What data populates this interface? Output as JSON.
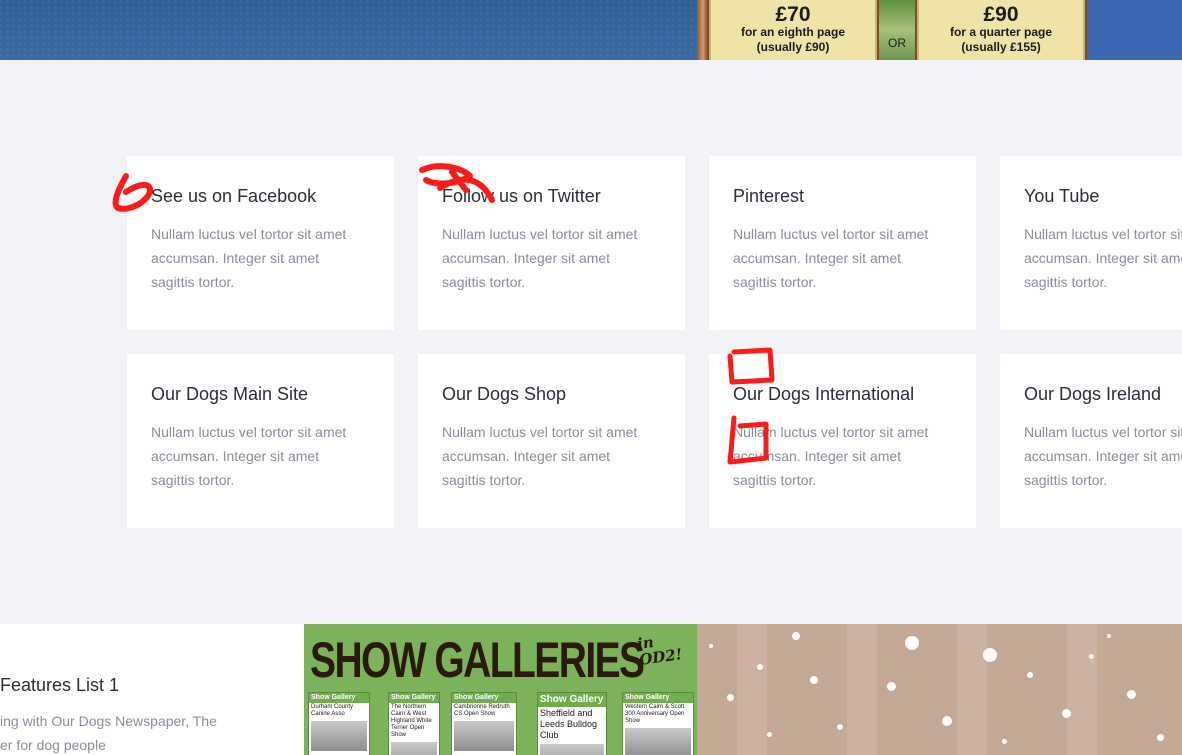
{
  "top_banner": {
    "offer_one": {
      "price": "£70",
      "line1": "for an eighth page",
      "line2": "(usually £90)"
    },
    "or_label": "OR",
    "offer_two": {
      "price": "£90",
      "line1": "for a quarter page",
      "line2": "(usually £155)"
    }
  },
  "cards": [
    {
      "title": "See us on Facebook",
      "text": [
        "Nullam luctus vel tortor sit amet",
        "accumsan. Integer sit amet",
        "sagittis tortor."
      ]
    },
    {
      "title": "Follow us on Twitter",
      "text": [
        "Nullam luctus vel tortor sit amet",
        "accumsan. Integer sit amet",
        "sagittis tortor."
      ]
    },
    {
      "title": "Pinterest",
      "text": [
        "Nullam luctus vel tortor sit amet",
        "accumsan. Integer sit amet",
        "sagittis tortor."
      ]
    },
    {
      "title": "You Tube",
      "text": [
        "Nullam luctus vel tortor sit amet",
        "accumsan. Integer sit amet",
        "sagittis tortor."
      ]
    },
    {
      "title": "Our Dogs Main Site",
      "text": [
        "Nullam luctus vel tortor sit amet",
        "accumsan. Integer sit amet",
        "sagittis tortor."
      ]
    },
    {
      "title": "Our Dogs Shop",
      "text": [
        "Nullam luctus vel tortor sit amet",
        "accumsan. Integer sit amet",
        "sagittis tortor."
      ]
    },
    {
      "title": "Our Dogs International",
      "text": [
        "Nullam luctus vel tortor sit amet",
        "accumsan. Integer sit amet",
        "sagittis tortor."
      ]
    },
    {
      "title": "Our Dogs Ireland",
      "text": [
        "Nullam luctus vel tortor sit amet",
        "accumsan. Integer sit amet",
        "sagittis tortor."
      ]
    }
  ],
  "features": {
    "title": "Features List 1",
    "text": [
      "ing with Our Dogs Newspaper, The",
      "er for dog people"
    ]
  },
  "gallery": {
    "headline": "SHOW GALLERIES",
    "suffix": "in OD2!",
    "pages": [
      {
        "header": "Show Gallery",
        "caption": "Durham County Canine Asso"
      },
      {
        "header": "Show Gallery",
        "caption": "The Northern Cairn & West Highland White Terrier Open Show"
      },
      {
        "header": "Show Gallery",
        "caption": "Cambrionne Redruth CS Open Show"
      },
      {
        "header": "Show Gallery",
        "caption": "Sheffield and Leeds Bulldog Club"
      },
      {
        "header": "Show Gallery",
        "caption": "Western Cairn & Scott 300 Anniversary Open Show"
      }
    ]
  },
  "colors": {
    "page_bg": "#f2f3f7",
    "card_bg": "#ffffff",
    "title_text": "#2a2f3b",
    "body_text": "#8a8f9c",
    "banner_blue": "#3e6cb0",
    "price_box": "#efe3a8",
    "gallery_green": "#7cb35a",
    "snow_bg": "#c4a896",
    "annotation_red": "#ff0000"
  }
}
